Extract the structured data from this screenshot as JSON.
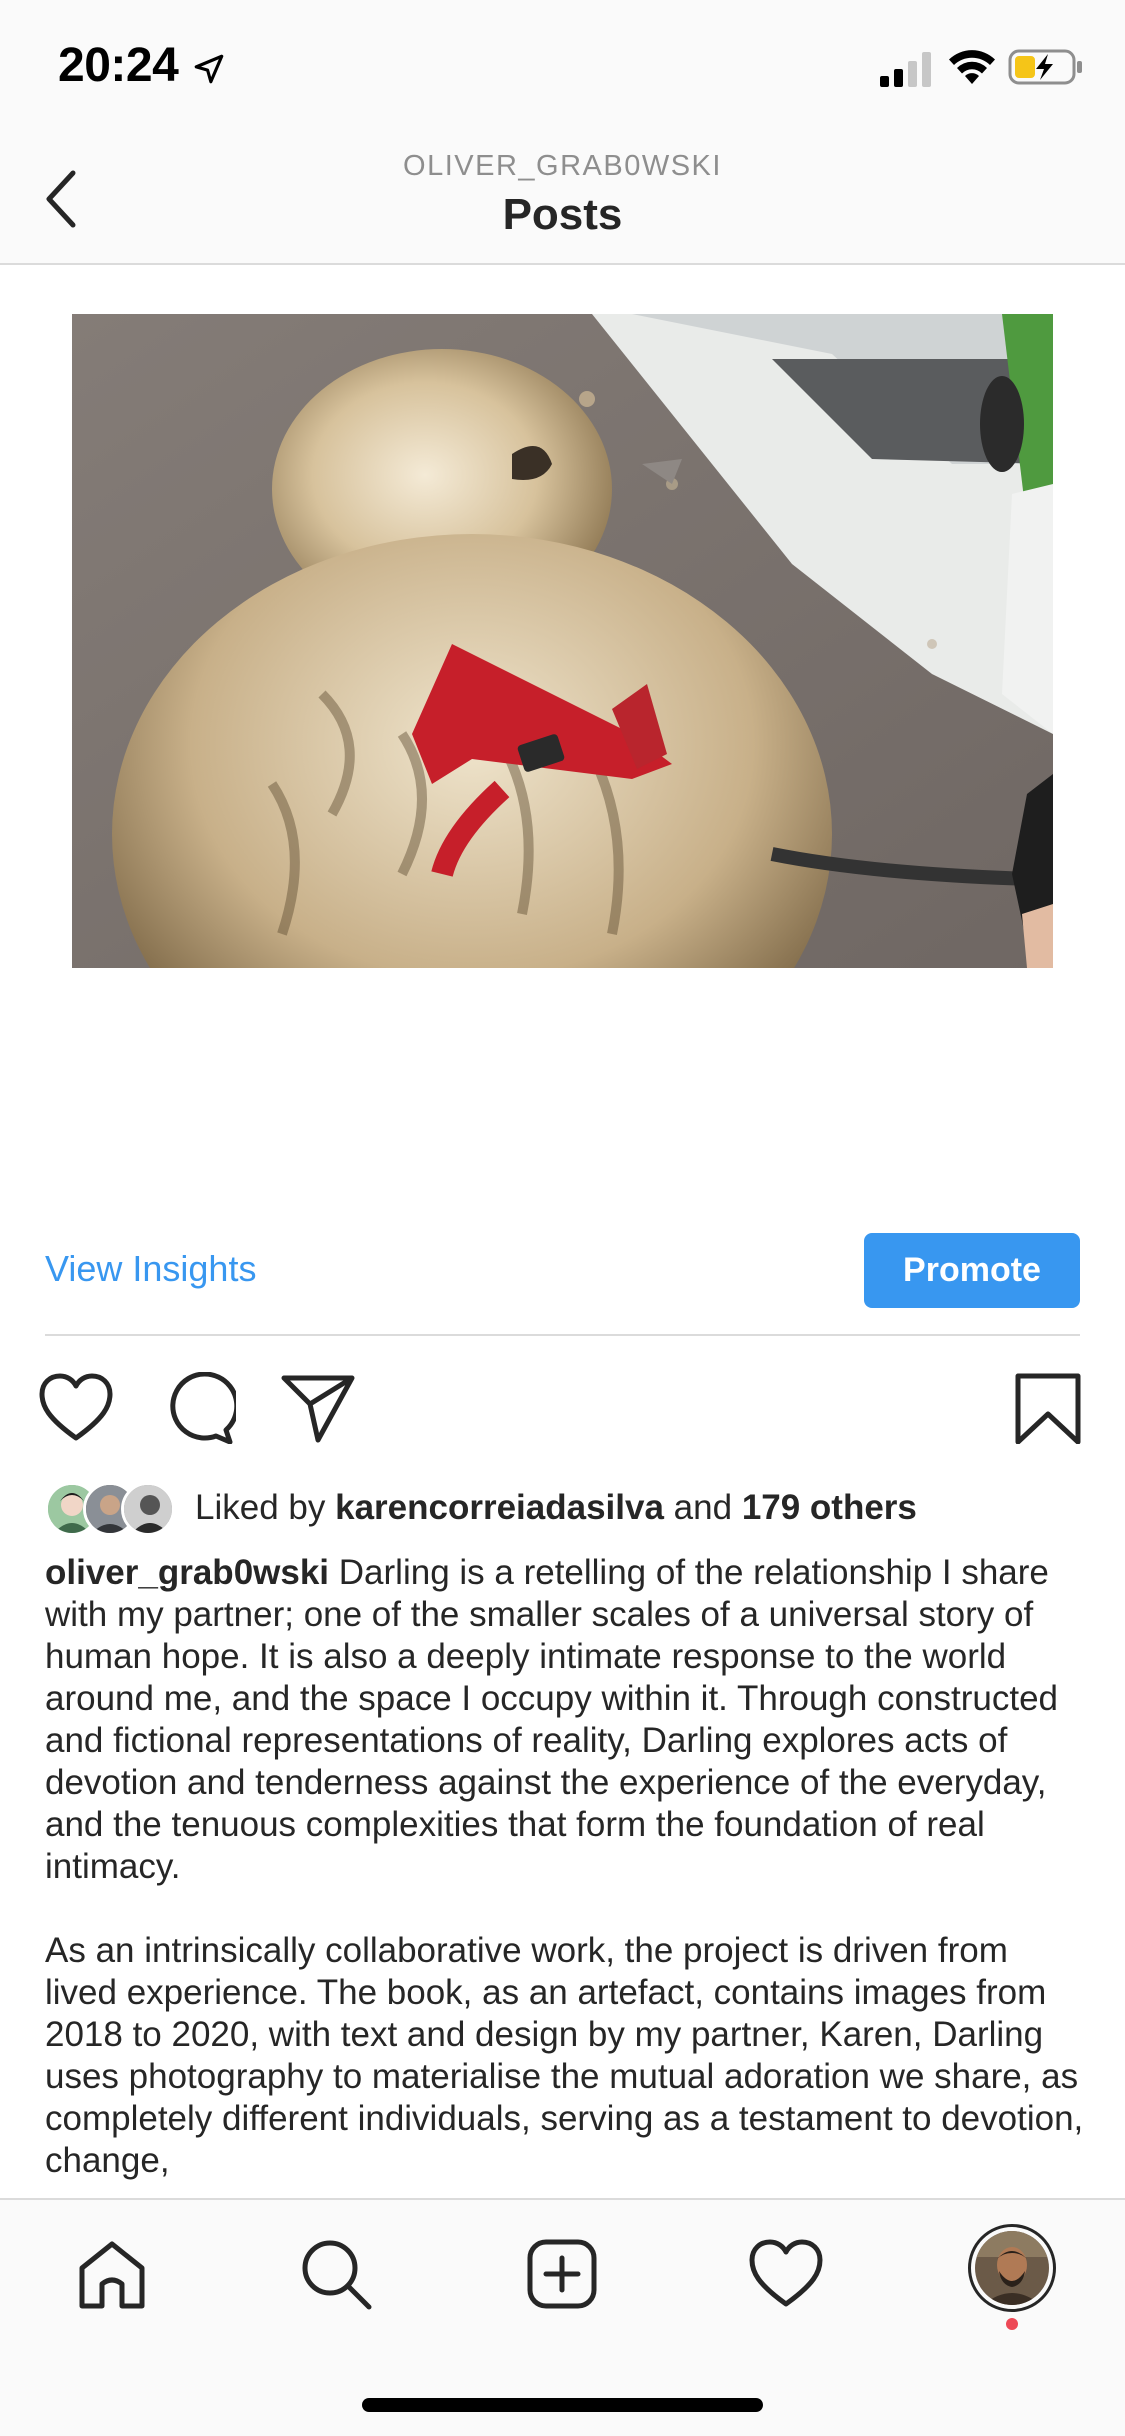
{
  "status_bar": {
    "time": "20:24",
    "icons": [
      "location-arrow-icon",
      "cellular-signal-icon",
      "wifi-icon",
      "battery-charging-icon"
    ]
  },
  "header": {
    "back_icon": "chevron-left-icon",
    "username": "OLIVER_GRAB0WSKI",
    "title": "Posts"
  },
  "post": {
    "image_alt": "Fluffy dog with red harness on a leash, seen from above on pavement",
    "insights_label": "View Insights",
    "promote_label": "Promote",
    "actions": [
      "heart-icon",
      "comment-icon",
      "share-icon",
      "bookmark-icon"
    ],
    "likes": {
      "prefix": "Liked by",
      "user": "karencorreiadasilva",
      "connector": "and",
      "others": "179 others"
    },
    "caption": {
      "username": "oliver_grab0wski",
      "paragraph1": "Darling is a retelling of the relationship I share with my partner; one of the smaller scales of a universal story of human hope. It is also a deeply intimate response to the world around me, and the space I occupy within it. Through constructed and fictional representations of reality, Darling explores acts of devotion and tenderness against the experience of the everyday, and the tenuous complexities that form the foundation of real intimacy.",
      "paragraph2": "As an intrinsically collaborative work, the project is driven from lived experience. The book, as an artefact, contains images from 2018 to 2020, with text and design by my partner, Karen, Darling uses photography to materialise the mutual adoration we share, as completely different individuals, serving as a testament to devotion, change,"
    }
  },
  "tab_bar": {
    "items": [
      "home-icon",
      "search-icon",
      "new-post-icon",
      "activity-heart-icon",
      "profile-avatar"
    ]
  },
  "colors": {
    "accent": "#3897f0",
    "text": "#262626",
    "muted": "#8e8e8e",
    "divider": "#dbdbdb",
    "notification": "#ed4956"
  }
}
